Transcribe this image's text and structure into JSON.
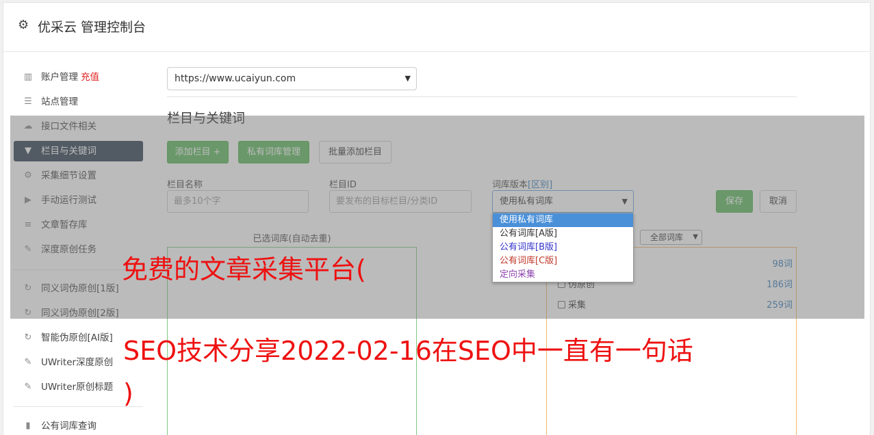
{
  "header": {
    "icon": "gear-icon",
    "title": "优采云 管理控制台"
  },
  "sidebar": {
    "items": [
      {
        "icon": "bar-chart-icon",
        "glyph": "▥",
        "label": "账户管理",
        "badge": "充值"
      },
      {
        "icon": "server-icon",
        "glyph": "☰",
        "label": "站点管理"
      },
      {
        "icon": "cloud-upload-icon",
        "glyph": "☁",
        "label": "接口文件相关"
      },
      {
        "icon": "filter-icon",
        "glyph": "▼",
        "label": "栏目与关键词",
        "active": true
      },
      {
        "icon": "cogs-icon",
        "glyph": "⚙",
        "label": "采集细节设置"
      },
      {
        "icon": "play-circle-icon",
        "glyph": "▶",
        "label": "手动运行测试"
      },
      {
        "icon": "database-icon",
        "glyph": "≡",
        "label": "文章暂存库"
      },
      {
        "icon": "edit-icon",
        "glyph": "✎",
        "label": "深度原创任务"
      },
      {
        "icon": "refresh-icon",
        "glyph": "↻",
        "label": "同义词伪原创[1版]"
      },
      {
        "icon": "refresh-icon",
        "glyph": "↻",
        "label": "同义词伪原创[2版]"
      },
      {
        "icon": "refresh-icon",
        "glyph": "↻",
        "label": "智能伪原创[AI版]"
      },
      {
        "icon": "edit-icon",
        "glyph": "✎",
        "label": "UWriter深度原创"
      },
      {
        "icon": "edit-icon",
        "glyph": "✎",
        "label": "UWriter原创标题"
      },
      {
        "icon": "book-icon",
        "glyph": "▮",
        "label": "公有词库查询"
      }
    ]
  },
  "site_select": {
    "value": "https://www.ucaiyun.com"
  },
  "section_title": "栏目与关键词",
  "buttons": {
    "add_column": "添加栏目 +",
    "private_lib": "私有词库管理",
    "batch_add": "批量添加栏目",
    "save": "保存",
    "cancel": "取消"
  },
  "form": {
    "name_label": "栏目名称",
    "name_placeholder": "最多10个字",
    "id_label": "栏目ID",
    "id_placeholder": "要发布的目标栏目/分类ID",
    "version_label": "词库版本",
    "version_link": "[区别]",
    "version_value": "使用私有词库"
  },
  "dropdown": {
    "options": [
      {
        "label": "使用私有词库",
        "color": "#ffffff",
        "selected": true
      },
      {
        "label": "公有词库[A版]",
        "color": "#333333"
      },
      {
        "label": "公有词库[B版]",
        "color": "#3333cc"
      },
      {
        "label": "公有词库[C版]",
        "color": "#c0392b"
      },
      {
        "label": "定向采集",
        "color": "#8e44ad"
      }
    ]
  },
  "chosen": {
    "title": "已选词库(自动去重)"
  },
  "library": {
    "filter_value": "全部词库",
    "rows": [
      {
        "label": "",
        "count": "98词"
      },
      {
        "label": "伪原创",
        "count": "186词"
      },
      {
        "label": "采集",
        "count": "259词"
      }
    ]
  },
  "watermark": {
    "line1": "免费的文章采集平台(",
    "line2": "SEO技术分享2022-02-16在SEO中一直有一句话",
    "line3": ")"
  },
  "colors": {
    "accent_green": "#5cb85c",
    "sidebar_active": "#2c3e50",
    "watermark": "#ee1111"
  }
}
